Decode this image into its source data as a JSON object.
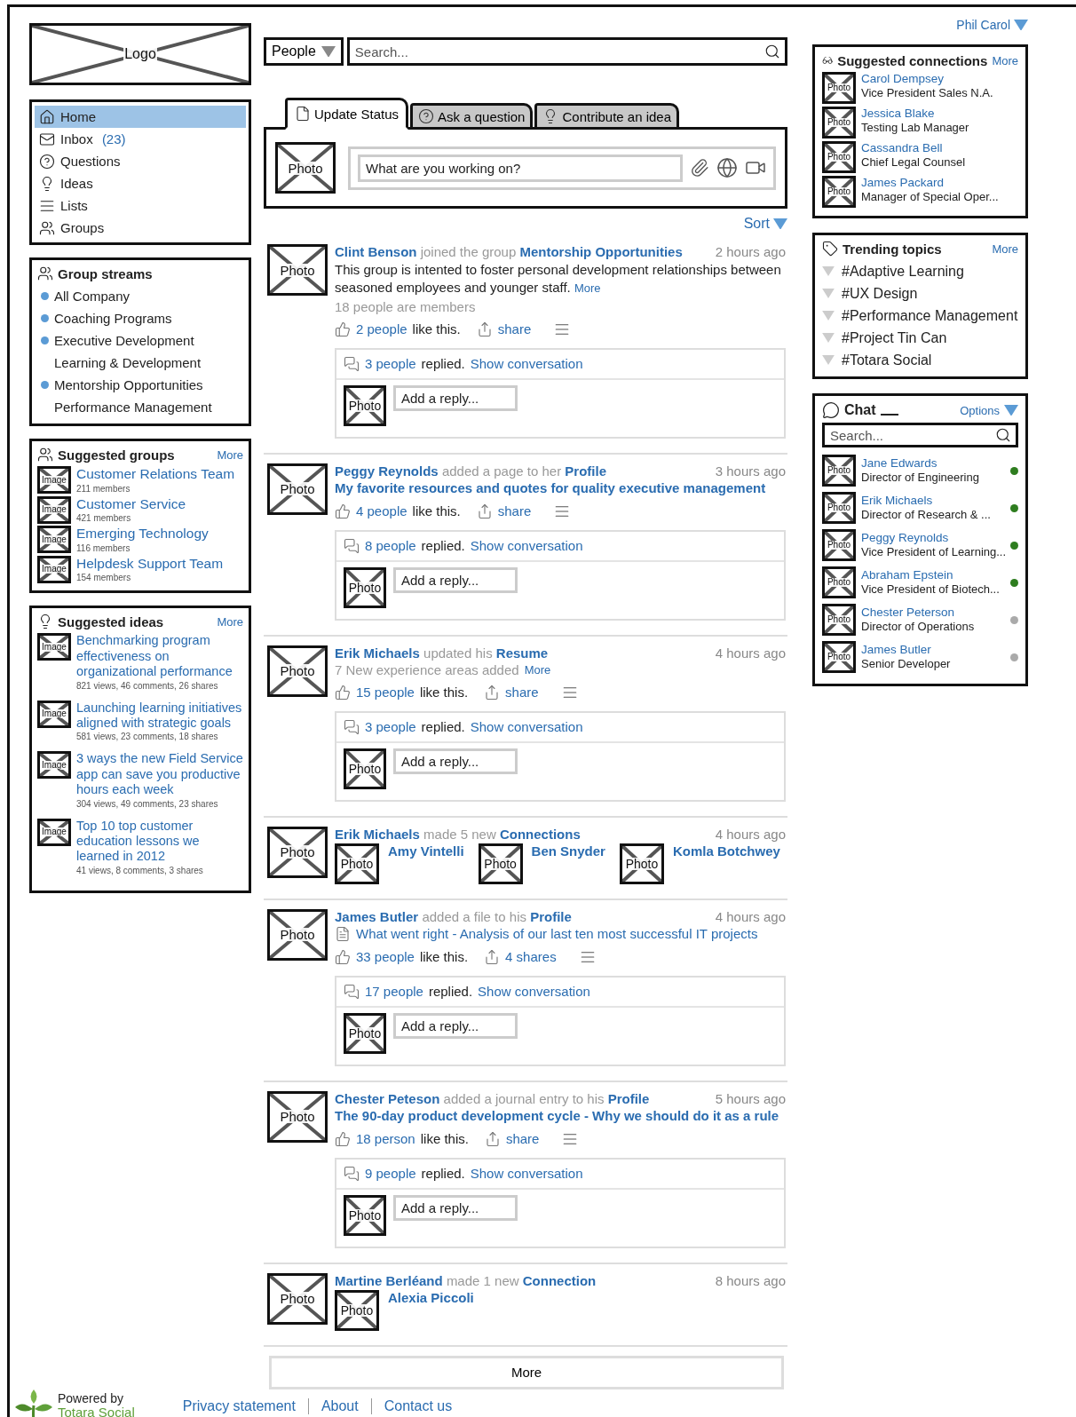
{
  "header": {
    "logo": "Logo",
    "user": "Phil Carol"
  },
  "nav": {
    "items": [
      {
        "kind": "home",
        "label": "Home",
        "selected": true
      },
      {
        "kind": "mail",
        "label": "Inbox",
        "count": "(23)",
        "selected": false
      },
      {
        "kind": "question",
        "label": "Questions",
        "selected": false
      },
      {
        "kind": "idea",
        "label": "Ideas",
        "selected": false
      },
      {
        "kind": "list",
        "label": "Lists",
        "selected": false
      },
      {
        "kind": "groups",
        "label": "Groups",
        "selected": false
      }
    ]
  },
  "group_streams": {
    "title": "Group streams",
    "items": [
      {
        "label": "All Company",
        "marked": true
      },
      {
        "label": "Coaching Programs",
        "marked": true
      },
      {
        "label": "Executive Development",
        "marked": true
      },
      {
        "label": "Learning & Development",
        "marked": false
      },
      {
        "label": "Mentorship Opportunities",
        "marked": true
      },
      {
        "label": "Performance Management",
        "marked": false
      }
    ]
  },
  "suggested_groups": {
    "title": "Suggested groups",
    "more": "More",
    "groups": [
      {
        "image": "Image",
        "name": "Customer Relations Team",
        "members": "211 members"
      },
      {
        "image": "Image",
        "name": "Customer Service",
        "members": "421 members"
      },
      {
        "image": "Image",
        "name": "Emerging Technology",
        "members": "116 members"
      },
      {
        "image": "Image",
        "name": "Helpdesk Support Team",
        "members": "154 members"
      }
    ]
  },
  "suggested_ideas": {
    "title": "Suggested ideas",
    "more": "More",
    "ideas": [
      {
        "image": "Image",
        "title": "Benchmarking program effectiveness on organizational performance",
        "stats": "821 views, 46 comments, 26 shares"
      },
      {
        "image": "Image",
        "title": "Launching learning initiatives aligned with strategic goals",
        "stats": "581 views, 23 comments, 18 shares"
      },
      {
        "image": "Image",
        "title": "3 ways the new Field Service app can save you productive hours each week",
        "stats": "304 views, 49 comments, 23 shares"
      },
      {
        "image": "Image",
        "title": "Top 10 top customer education lessons we learned in 2012",
        "stats": "41 views, 8 comments, 3 shares"
      }
    ]
  },
  "search": {
    "scope": "People",
    "placeholder": "Search..."
  },
  "composer": {
    "tabs": [
      {
        "kind": "status",
        "label": "Update Status",
        "selected": true
      },
      {
        "kind": "question",
        "label": "Ask a question",
        "selected": false
      },
      {
        "kind": "idea",
        "label": "Contribute an idea",
        "selected": false
      }
    ],
    "avatar": "Photo",
    "placeholder": "What are you working on?"
  },
  "feed": {
    "sort": "Sort",
    "more": "More",
    "items": [
      {
        "avatar": "Photo",
        "actor": "Clint Benson",
        "action": "joined the group",
        "target": "Mentorship Opportunities",
        "time": "2 hours ago",
        "detail": {
          "kind": "text",
          "text": "This group is intented to foster personal development relationships between seasoned employees and younger staff.",
          "more": "More"
        },
        "members": "18 people are members",
        "likes": {
          "count": "2 people",
          "label": "like this.",
          "share": "share"
        },
        "replies": {
          "count": "3 people",
          "label": "replied.",
          "link": "Show conversation",
          "avatar": "Photo",
          "placeholder": "Add a reply..."
        }
      },
      {
        "avatar": "Photo",
        "actor": "Peggy Reynolds",
        "action": "added a page to her",
        "target": "Profile",
        "time": "3 hours ago",
        "detail": {
          "kind": "title",
          "text": "My favorite resources and quotes for quality executive management"
        },
        "likes": {
          "count": "4 people",
          "label": "like this.",
          "share": "share"
        },
        "replies": {
          "count": "8 people",
          "label": "replied.",
          "link": "Show conversation",
          "avatar": "Photo",
          "placeholder": "Add a reply..."
        }
      },
      {
        "avatar": "Photo",
        "actor": "Erik Michaels",
        "action": "updated his",
        "target": "Resume",
        "time": "4 hours ago",
        "detail": {
          "kind": "note",
          "text": "7 New experience areas added",
          "more": "More"
        },
        "likes": {
          "count": "15 people",
          "label": "like this.",
          "share": "share"
        },
        "replies": {
          "count": "3 people",
          "label": "replied.",
          "link": "Show conversation",
          "avatar": "Photo",
          "placeholder": "Add a reply..."
        }
      },
      {
        "avatar": "Photo",
        "actor": "Erik Michaels",
        "action": "made 5 new",
        "target": "Connections",
        "time": "4 hours ago",
        "connections": [
          {
            "avatar": "Photo",
            "name": "Amy Vintelli"
          },
          {
            "avatar": "Photo",
            "name": "Ben Snyder"
          },
          {
            "avatar": "Photo",
            "name": "Komla Botchwey"
          }
        ]
      },
      {
        "avatar": "Photo",
        "actor": "James Butler",
        "action": "added a file to his",
        "target": "Profile",
        "time": "4 hours ago",
        "detail": {
          "kind": "file",
          "text": "What went right - Analysis of our last ten most successful IT projects"
        },
        "likes": {
          "count": "33 people",
          "label": "like this.",
          "share": "4 shares"
        },
        "replies": {
          "count": "17 people",
          "label": "replied.",
          "link": "Show conversation",
          "avatar": "Photo",
          "placeholder": "Add a reply..."
        }
      },
      {
        "avatar": "Photo",
        "actor": "Chester Peteson",
        "action": "added a journal entry to his",
        "target": "Profile",
        "time": "5 hours ago",
        "detail": {
          "kind": "title",
          "text": "The 90-day product development cycle - Why we should do it as a rule"
        },
        "likes": {
          "count": "18 person",
          "label": "like this.",
          "share": "share"
        },
        "replies": {
          "count": "9 people",
          "label": "replied.",
          "link": "Show conversation",
          "avatar": "Photo",
          "placeholder": "Add a reply..."
        }
      },
      {
        "avatar": "Photo",
        "actor": "Martine Berléand",
        "action": "made 1 new",
        "target": "Connection",
        "time": "8 hours ago",
        "connections": [
          {
            "avatar": "Photo",
            "name": "Alexia Piccoli"
          }
        ]
      }
    ]
  },
  "suggested_connections": {
    "title": "Suggested connections",
    "more": "More",
    "people": [
      {
        "avatar": "Photo",
        "name": "Carol Dempsey",
        "role": "Vice President Sales N.A."
      },
      {
        "avatar": "Photo",
        "name": "Jessica Blake",
        "role": "Testing Lab Manager"
      },
      {
        "avatar": "Photo",
        "name": "Cassandra Bell",
        "role": "Chief Legal Counsel"
      },
      {
        "avatar": "Photo",
        "name": "James Packard",
        "role": "Manager of Special Oper..."
      }
    ]
  },
  "trending": {
    "title": "Trending topics",
    "more": "More",
    "topics": [
      "#Adaptive Learning",
      "#UX Design",
      "#Performance Management",
      "#Project Tin Can",
      "#Totara Social"
    ]
  },
  "chat": {
    "title": "Chat",
    "options": "Options",
    "placeholder": "Search...",
    "people": [
      {
        "avatar": "Photo",
        "name": "Jane Edwards",
        "role": "Director of Engineering",
        "color": "#2e7d1f"
      },
      {
        "avatar": "Photo",
        "name": "Erik Michaels",
        "role": "Director of Research & ...",
        "color": "#2e7d1f"
      },
      {
        "avatar": "Photo",
        "name": "Peggy Reynolds",
        "role": "Vice President of Learning...",
        "color": "#2e7d1f"
      },
      {
        "avatar": "Photo",
        "name": "Abraham Epstein",
        "role": "Vice President of Biotech...",
        "color": "#2e7d1f"
      },
      {
        "avatar": "Photo",
        "name": "Chester Peterson",
        "role": "Director of Operations",
        "color": "#aaaaaa"
      },
      {
        "avatar": "Photo",
        "name": "James Butler",
        "role": "Senior Developer",
        "color": "#aaaaaa"
      }
    ]
  },
  "footer": {
    "powered": "Powered by",
    "brand": "Totara Social",
    "links": [
      "Privacy statement",
      "About",
      "Contact us"
    ]
  }
}
